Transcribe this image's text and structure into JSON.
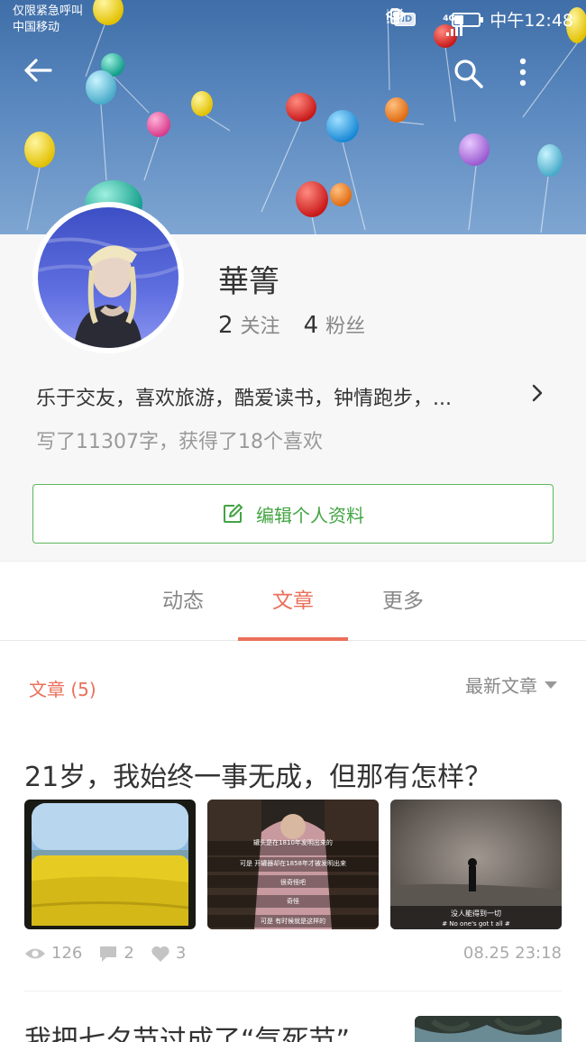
{
  "status_bar": {
    "carrier_line1": "仅限紧急呼叫",
    "carrier_line2": "中国移动",
    "hd_badge": "HD",
    "network": "4G",
    "time": "中午12:48",
    "battery_level": 0.35
  },
  "toolbar": {
    "back_icon": "arrow-left-icon",
    "search_icon": "search-icon",
    "more_icon": "more-vertical-icon"
  },
  "profile": {
    "username": "華箐",
    "following_count": "2",
    "following_label": "关注",
    "followers_count": "4",
    "followers_label": "粉丝",
    "bio": "乐于交友，喜欢旅游，酷爱读书，钟情跑步，...",
    "summary": "写了11307字，获得了18个喜欢",
    "edit_button_label": "编辑个人资料"
  },
  "tabs": [
    {
      "label": "动态",
      "active": false
    },
    {
      "label": "文章",
      "active": true
    },
    {
      "label": "更多",
      "active": false
    }
  ],
  "list": {
    "title": "文章 (5)",
    "sort_label": "最新文章"
  },
  "articles": [
    {
      "title": "21岁，我始终一事无成，但那有怎样？",
      "views": "126",
      "comments": "2",
      "likes": "3",
      "date": "08.25 23:18",
      "thumbnail_captions": [
        [
          "罐头是在1810年发明出来的",
          "可是 开罐器却在1858年才被发明出来",
          "很奇怪吧",
          "奇怪",
          "可是 有时候就是这样的"
        ],
        [
          "没人能得到一切",
          "# No one's got t all #"
        ]
      ]
    },
    {
      "title": "我把七夕节过成了“气死节”"
    }
  ],
  "colors": {
    "accent": "#ea6f5a",
    "green": "#42a442",
    "muted": "#999999"
  }
}
